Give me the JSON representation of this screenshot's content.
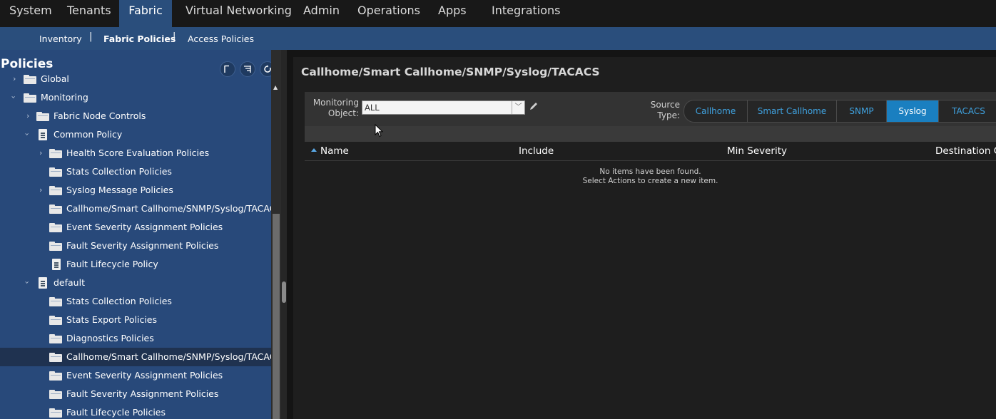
{
  "top_nav": {
    "tabs": [
      "System",
      "Tenants",
      "Fabric",
      "Virtual Networking",
      "Admin",
      "Operations",
      "Apps",
      "Integrations"
    ],
    "active": "Fabric"
  },
  "sub_nav": {
    "items": [
      "Inventory",
      "Fabric Policies",
      "Access Policies"
    ],
    "active": "Fabric Policies",
    "separator": "|"
  },
  "left_panel": {
    "title": "Policies",
    "controls": [
      "flag-icon",
      "collapse-list-icon",
      "refresh-icon"
    ],
    "tree": [
      {
        "label": "Global",
        "icon": "folder",
        "expandable": true
      },
      {
        "label": "Monitoring",
        "icon": "folder",
        "expanded": true
      },
      {
        "label": "Fabric Node Controls",
        "icon": "folder",
        "expandable": true
      },
      {
        "label": "Common Policy",
        "icon": "document",
        "expanded": true
      },
      {
        "label": "Health Score Evaluation Policies",
        "icon": "folder",
        "expandable": true
      },
      {
        "label": "Stats Collection Policies",
        "icon": "folder"
      },
      {
        "label": "Syslog Message Policies",
        "icon": "folder",
        "expandable": true
      },
      {
        "label": "Callhome/Smart Callhome/SNMP/Syslog/TACACS",
        "icon": "folder"
      },
      {
        "label": "Event Severity Assignment Policies",
        "icon": "folder"
      },
      {
        "label": "Fault Severity Assignment Policies",
        "icon": "folder"
      },
      {
        "label": "Fault Lifecycle Policy",
        "icon": "document"
      },
      {
        "label": "default",
        "icon": "document",
        "expanded": true
      },
      {
        "label": "Stats Collection Policies",
        "icon": "folder"
      },
      {
        "label": "Stats Export Policies",
        "icon": "folder"
      },
      {
        "label": "Diagnostics Policies",
        "icon": "folder"
      },
      {
        "label": "Callhome/Smart Callhome/SNMP/Syslog/TACACS",
        "icon": "folder",
        "selected": true
      },
      {
        "label": "Event Severity Assignment Policies",
        "icon": "folder"
      },
      {
        "label": "Fault Severity Assignment Policies",
        "icon": "folder"
      },
      {
        "label": "Fault Lifecycle Policies",
        "icon": "folder"
      }
    ]
  },
  "main": {
    "title": "Callhome/Smart Callhome/SNMP/Syslog/TACACS",
    "monitoring_object": {
      "label": "Monitoring Object:",
      "label_line1": "Monitoring",
      "label_line2": "Object:",
      "value": "ALL"
    },
    "source_type": {
      "label_line1": "Source",
      "label_line2": "Type:",
      "options": [
        "Callhome",
        "Smart Callhome",
        "SNMP",
        "Syslog",
        "TACACS"
      ],
      "selected": "Syslog"
    },
    "table": {
      "columns": [
        "Name",
        "Include",
        "Min Severity",
        "Destination G"
      ],
      "empty_line1": "No items have been found.",
      "empty_line2": "Select Actions to create a new item."
    }
  },
  "colors": {
    "nav_blue": "#2a4e7c",
    "tree_bg": "#28497a",
    "accent": "#1a7fc0",
    "link_blue": "#3fa2e0"
  }
}
